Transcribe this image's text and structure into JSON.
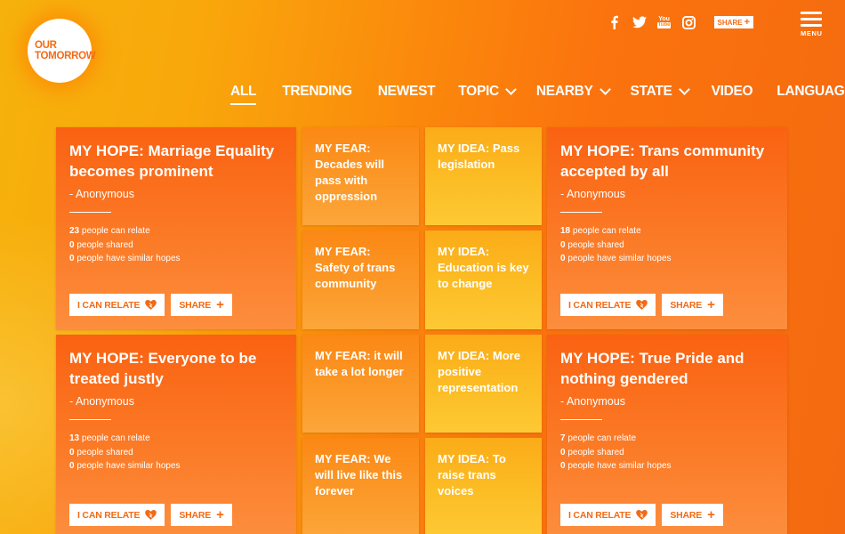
{
  "logo": {
    "line1": "OUR",
    "line2": "TOMORROW"
  },
  "social": {
    "facebook": "f",
    "youtube_top": "You",
    "youtube_bottom": "Tube",
    "share_label": "SHARE",
    "share_plus": "+"
  },
  "menu_label": "MENU",
  "nav": [
    {
      "label": "ALL",
      "active": true,
      "dropdown": false
    },
    {
      "label": "TRENDING",
      "dropdown": false
    },
    {
      "label": "NEWEST",
      "dropdown": false
    },
    {
      "label": "TOPIC",
      "dropdown": true
    },
    {
      "label": "NEARBY",
      "dropdown": true
    },
    {
      "label": "STATE",
      "dropdown": true
    },
    {
      "label": "VIDEO",
      "dropdown": false
    },
    {
      "label": "LANGUAGE",
      "dropdown": true
    }
  ],
  "buttons": {
    "relate": "I CAN RELATE",
    "share": "SHARE",
    "plus": "+"
  },
  "stat_labels": {
    "relate": "people can relate",
    "shared": "people shared",
    "similar": "people have similar hopes"
  },
  "hopes": [
    {
      "title": "MY HOPE: Marriage Equality becomes prominent",
      "author": "- Anonymous",
      "relate": "23",
      "shared": "0",
      "similar": "0"
    },
    {
      "title": "MY HOPE: Trans community accepted by all",
      "author": "- Anonymous",
      "relate": "18",
      "shared": "0",
      "similar": "0"
    },
    {
      "title": "MY HOPE: Everyone to be treated justly",
      "author": "- Anonymous",
      "relate": "13",
      "shared": "0",
      "similar": "0"
    },
    {
      "title": "MY HOPE: True Pride and nothing gendered",
      "author": "- Anonymous",
      "relate": "7",
      "shared": "0",
      "similar": "0"
    }
  ],
  "fears": [
    "MY FEAR: Decades will pass with oppression",
    "MY FEAR: Safety of trans community",
    "MY FEAR: it will take a lot longer",
    "MY FEAR: We will live like this forever"
  ],
  "ideas": [
    "MY IDEA: Pass legislation",
    "MY IDEA: Education is key to change",
    "MY IDEA: More positive representation",
    "MY IDEA: To raise trans voices"
  ],
  "colors": {
    "accent": "#f36a14",
    "hope_card": "#fa6212",
    "fear_card": "#fb8814",
    "idea_card": "#fbac18"
  }
}
